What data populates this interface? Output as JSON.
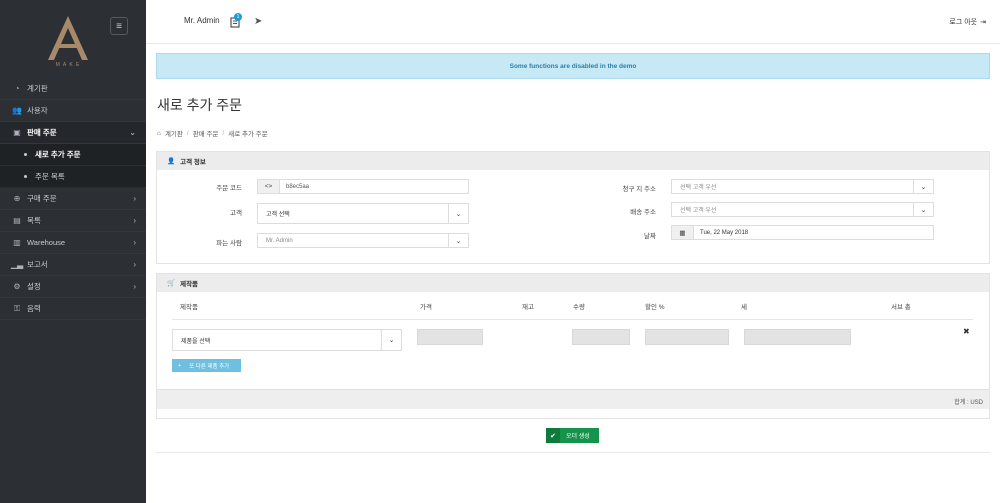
{
  "brand": {
    "letter": "A",
    "word": "M A K E",
    "color": "#a88a6a"
  },
  "sidebar": {
    "items": [
      {
        "label": "계기판",
        "icon": "dashboard-icon"
      },
      {
        "label": "사용자",
        "icon": "users-icon"
      },
      {
        "label": "판매 주문",
        "icon": "sales-icon",
        "active": true
      },
      {
        "label": "새로 추가 주문",
        "sub": true,
        "current": true
      },
      {
        "label": "주문 목록",
        "sub": true
      },
      {
        "label": "구매 주문",
        "icon": "purchase-icon"
      },
      {
        "label": "목록",
        "icon": "list-icon"
      },
      {
        "label": "Warehouse",
        "icon": "warehouse-icon"
      },
      {
        "label": "보고서",
        "icon": "report-icon"
      },
      {
        "label": "설정",
        "icon": "settings-icon"
      },
      {
        "label": "음력",
        "icon": "key-icon"
      }
    ]
  },
  "topbar": {
    "user": "Mr. Admin",
    "badge": "1",
    "logout": "로그 아웃"
  },
  "alert": "Some functions are disabled in the demo",
  "page_title": "새로 추가 주문",
  "breadcrumb": [
    "계기판",
    "판매 주문",
    "새로 추가 주문"
  ],
  "customer_panel": {
    "title": "고객 정보",
    "order_code_label": "주문 코드",
    "order_code_value": "b8ec5aa",
    "customer_label": "고객",
    "customer_value": "고객 선택",
    "seller_label": "파는 사람",
    "seller_value": "Mr. Admin",
    "billing_label": "청구 지 주소",
    "billing_value": "선택 고객 우선",
    "shipping_label": "배송 주소",
    "shipping_value": "선택 고객 우선",
    "date_label": "날짜",
    "date_value": "Tue, 22 May 2018"
  },
  "products_panel": {
    "title": "제작품",
    "columns": [
      "제작품",
      "가격",
      "재고",
      "수량",
      "할인 %",
      "세",
      "서브 총"
    ],
    "product_select": "제품을 선택",
    "add_button": "또 다른 제품 추가",
    "total": "합계 : USD"
  },
  "submit": "오더 생성"
}
